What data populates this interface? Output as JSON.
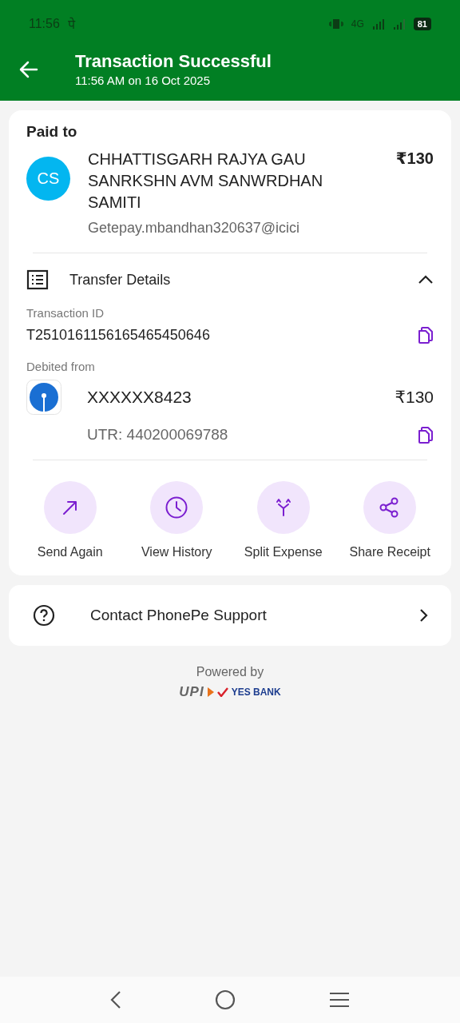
{
  "status_bar": {
    "time": "11:56",
    "notification": "पे",
    "network": "4G",
    "battery": "81"
  },
  "header": {
    "title": "Transaction Successful",
    "subtitle": "11:56 AM on 16 Oct 2025"
  },
  "payee": {
    "heading": "Paid to",
    "initials": "CS",
    "name": "CHHATTISGARH RAJYA GAU SANRKSHN AVM SANWRDHAN SAMITI",
    "upi_id": "Getepay.mbandhan320637@icici",
    "amount": "₹130"
  },
  "transfer_details": {
    "title": "Transfer Details",
    "expanded": true,
    "transaction_id_label": "Transaction ID",
    "transaction_id": "T2510161156165465450646",
    "debited_label": "Debited from",
    "account": "XXXXXX8423",
    "amount": "₹130",
    "utr": "UTR: 440200069788"
  },
  "actions": [
    {
      "kind": "send",
      "label": "Send Again"
    },
    {
      "kind": "history",
      "label": "View History"
    },
    {
      "kind": "split",
      "label": "Split Expense"
    },
    {
      "kind": "share",
      "label": "Share Receipt"
    }
  ],
  "support": {
    "label": "Contact PhonePe Support"
  },
  "footer": {
    "powered_by": "Powered by",
    "upi_logo": "UPI",
    "bank_logo": "YES BANK"
  }
}
